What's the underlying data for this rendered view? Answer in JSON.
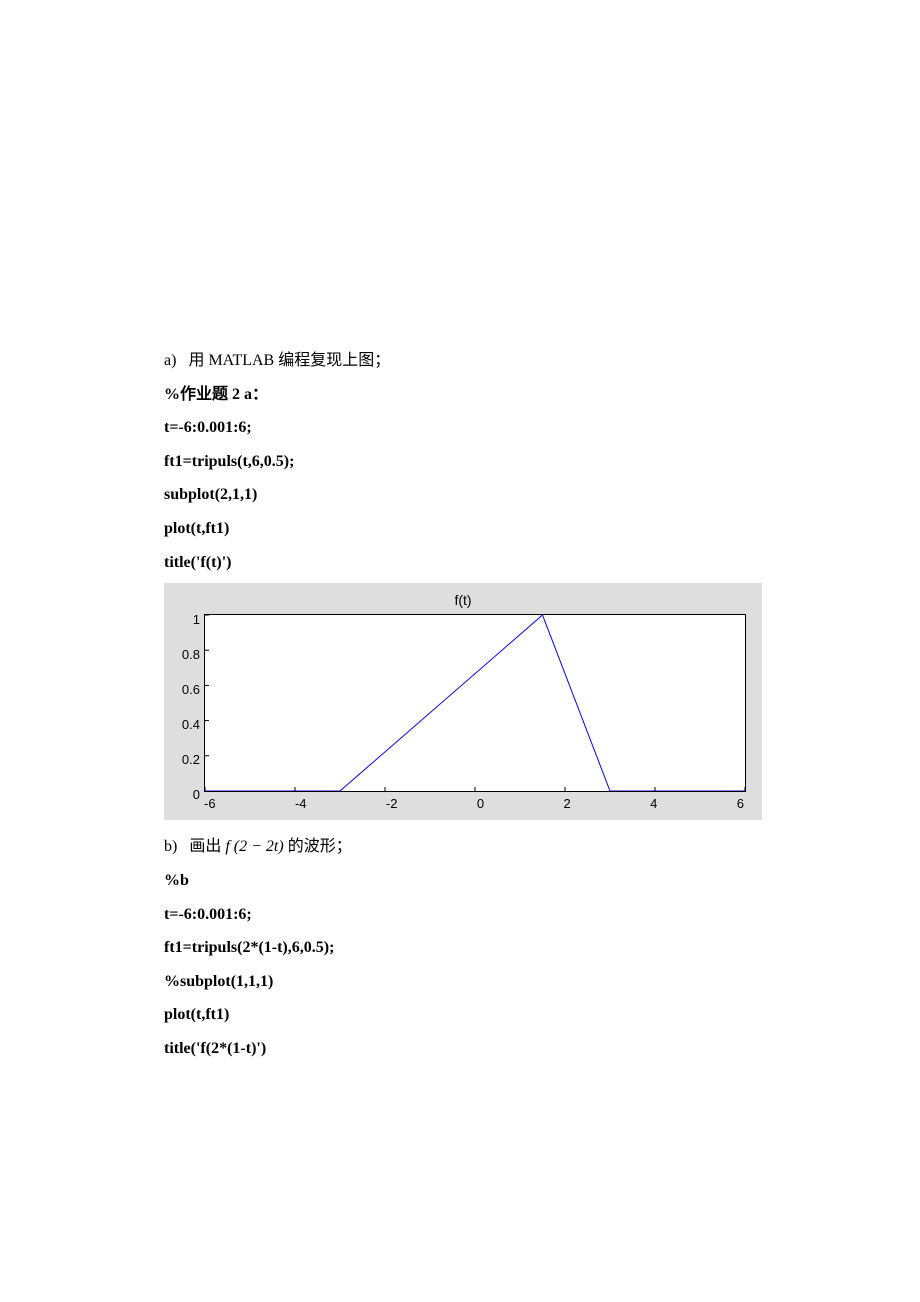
{
  "text": {
    "a_label": "a)",
    "a_desc": "用 MATLAB 编程复现上图；",
    "comment_a": "%作业题 2   a：",
    "code_a1": "t=-6:0.001:6;",
    "code_a2": "ft1=tripuls(t,6,0.5);",
    "code_a3": "subplot(2,1,1)",
    "code_a4": "plot(t,ft1)",
    "code_a5": "title('f(t)')",
    "b_label": "b)",
    "b_desc_pre": "画出 ",
    "b_desc_mid": "f (2 − 2t)",
    "b_desc_post": " 的波形；",
    "comment_b": "%b",
    "code_b1": "t=-6:0.001:6;",
    "code_b2": "ft1=tripuls(2*(1-t),6,0.5);",
    "code_b3": "%subplot(1,1,1)",
    "code_b4": "plot(t,ft1)",
    "code_b5": "title('f(2*(1-t)')"
  },
  "chart_data": {
    "type": "line",
    "title": "f(t)",
    "xlabel": "",
    "ylabel": "",
    "xlim": [
      -6,
      6
    ],
    "ylim": [
      0,
      1
    ],
    "xticks": [
      -6,
      -4,
      -2,
      0,
      2,
      4,
      6
    ],
    "yticks": [
      0,
      0.2,
      0.4,
      0.6,
      0.8,
      1
    ],
    "series": [
      {
        "name": "f(t)",
        "x": [
          -6,
          -3,
          1.5,
          3,
          6
        ],
        "y": [
          0,
          0,
          1,
          0,
          0
        ],
        "color": "#0000ff"
      }
    ]
  }
}
